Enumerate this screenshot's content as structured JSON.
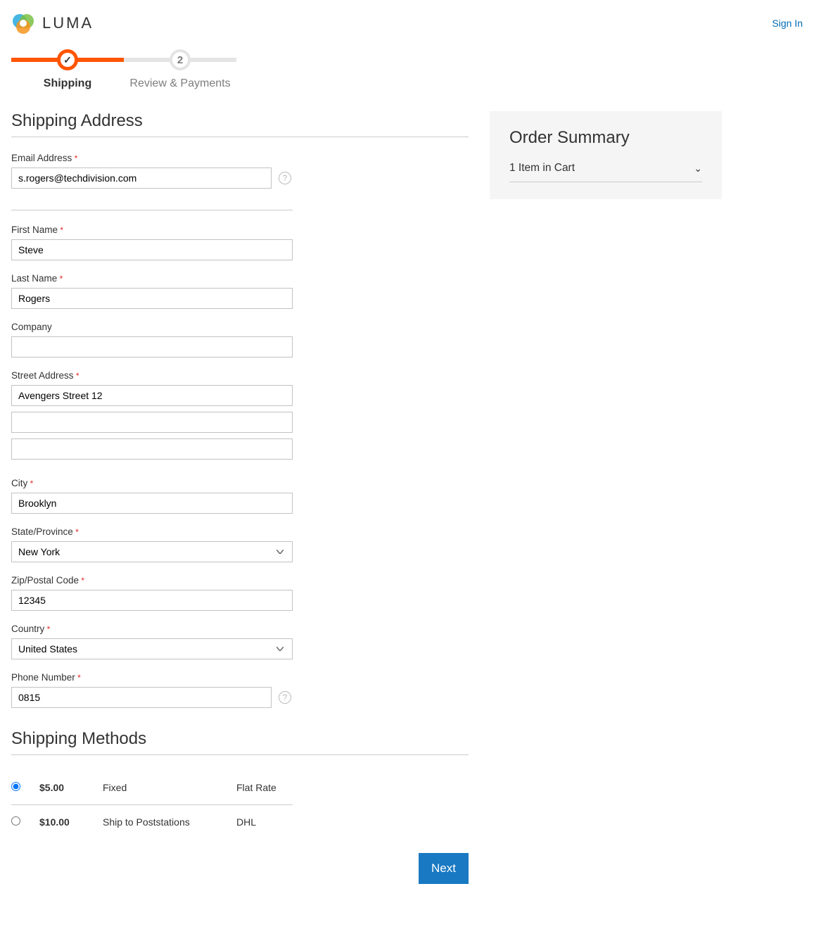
{
  "header": {
    "brand": "LUMA",
    "signin": "Sign In"
  },
  "progress": {
    "step1": {
      "label": "Shipping"
    },
    "step2": {
      "label": "Review & Payments",
      "num": "2"
    }
  },
  "shipping_address": {
    "title": "Shipping Address",
    "email_label": "Email Address",
    "email_value": "s.rogers@techdivision.com",
    "first_name_label": "First Name",
    "first_name_value": "Steve",
    "last_name_label": "Last Name",
    "last_name_value": "Rogers",
    "company_label": "Company",
    "company_value": "",
    "street_label": "Street Address",
    "street1": "Avengers Street 12",
    "street2": "",
    "street3": "",
    "city_label": "City",
    "city_value": "Brooklyn",
    "state_label": "State/Province",
    "state_value": "New York",
    "zip_label": "Zip/Postal Code",
    "zip_value": "12345",
    "country_label": "Country",
    "country_value": "United States",
    "phone_label": "Phone Number",
    "phone_value": "0815"
  },
  "shipping_methods": {
    "title": "Shipping Methods",
    "rows": [
      {
        "price": "$5.00",
        "title": "Fixed",
        "carrier": "Flat Rate",
        "selected": true
      },
      {
        "price": "$10.00",
        "title": "Ship to Poststations",
        "carrier": "DHL",
        "selected": false
      }
    ]
  },
  "order_summary": {
    "title": "Order Summary",
    "cart_line": "1 Item in Cart"
  },
  "actions": {
    "next": "Next"
  }
}
